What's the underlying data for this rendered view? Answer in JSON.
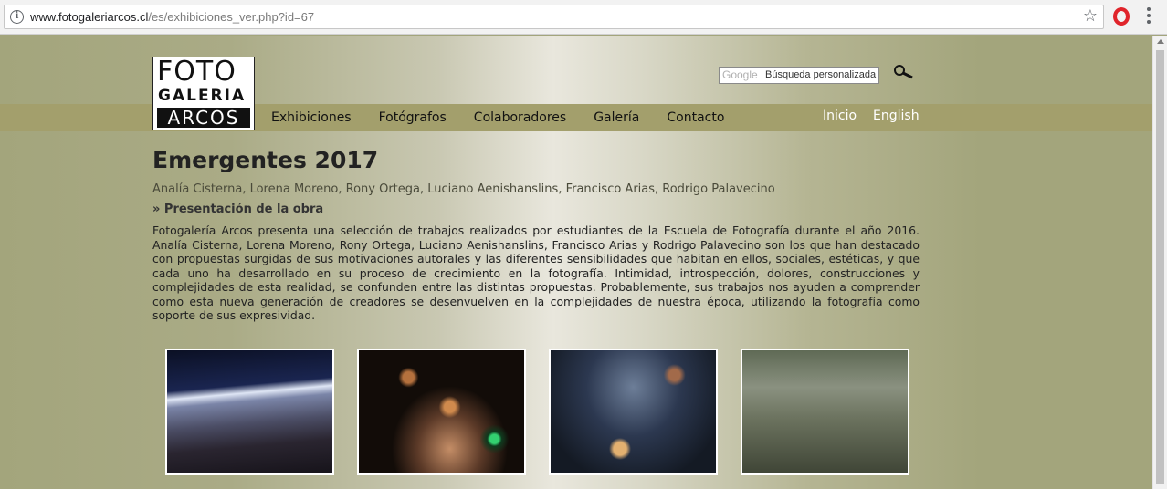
{
  "browser": {
    "url_domain": "www.fotogaleriarcos.cl",
    "url_path": "/es/exhibiciones_ver.php?id=67"
  },
  "logo": {
    "line1": "FOTO",
    "line2": "GALERIA",
    "line3": "ARCOS"
  },
  "search": {
    "brand": "Google",
    "placeholder": "Búsqueda personalizada"
  },
  "nav": {
    "items": [
      "Exhibiciones",
      "Fotógrafos",
      "Colaboradores",
      "Galería",
      "Contacto"
    ],
    "right": [
      "Inicio",
      "English"
    ]
  },
  "exhibition": {
    "title": "Emergentes 2017",
    "authors": [
      "Analía Cisterna",
      "Lorena Moreno",
      "Rony Ortega",
      "Luciano Aenishanslins",
      "Francisco Arias",
      "Rodrigo Palavecino"
    ],
    "section_heading": "» Presentación de la obra",
    "description": "Fotogalería Arcos presenta una selección de trabajos realizados por estudiantes de la Escuela de Fotografía durante el año 2016. Analía Cisterna, Lorena Moreno, Rony Ortega, Luciano Aenishanslins, Francisco Arias y Rodrigo Palavecino son los que han destacado con propuestas surgidas de sus motivaciones autorales y las diferentes sensibilidades que habitan en ellos, sociales, estéticas, y que cada uno ha desarrollado en su proceso de crecimiento en la fotografía. Intimidad, introspección, dolores, construcciones y complejidades de esta realidad, se confunden entre las distintas propuestas. Probablemente, sus trabajos nos ayuden a comprender como esta nueva generación de creadores se desenvuelven en la complejidades de nuestra época, utilizando la fotografía como soporte de sus expresividad."
  },
  "colors": {
    "band": "#a39f6c",
    "background": "#a3a57c",
    "nav_right_text": "#ffffff"
  }
}
